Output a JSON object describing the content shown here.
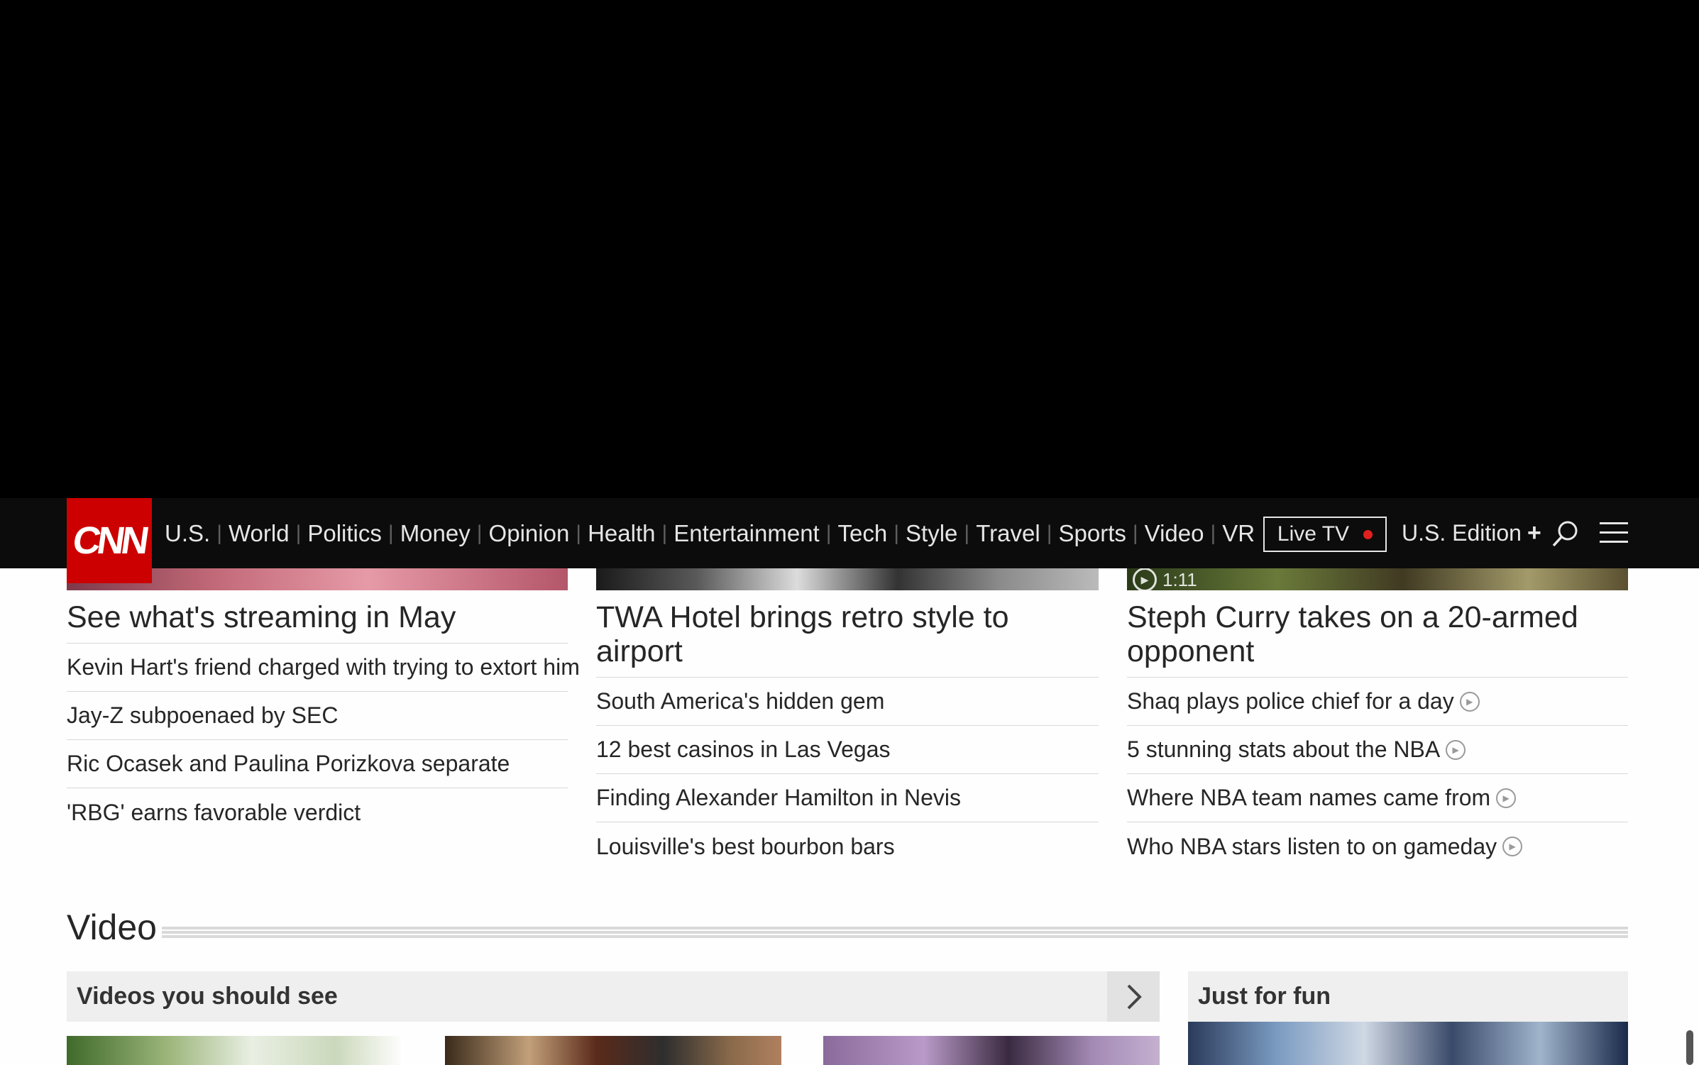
{
  "nav": {
    "logo": "CNN",
    "links": [
      "U.S.",
      "World",
      "Politics",
      "Money",
      "Opinion",
      "Health",
      "Entertainment",
      "Tech",
      "Style",
      "Travel",
      "Sports",
      "Video",
      "VR"
    ],
    "live_tv": "Live TV",
    "edition": "U.S. Edition",
    "edition_plus": "+"
  },
  "columns": [
    {
      "headline": "See what's streaming in May",
      "stories": [
        {
          "text": "Kevin Hart's friend charged with trying to extort him"
        },
        {
          "text": "Jay-Z subpoenaed by SEC"
        },
        {
          "text": "Ric Ocasek and Paulina Porizkova separate"
        },
        {
          "text": "'RBG' earns favorable verdict"
        }
      ]
    },
    {
      "headline": "TWA Hotel brings retro style to airport",
      "stories": [
        {
          "text": "South America's hidden gem"
        },
        {
          "text": "12 best casinos in Las Vegas"
        },
        {
          "text": "Finding Alexander Hamilton in Nevis"
        },
        {
          "text": "Louisville's best bourbon bars"
        }
      ]
    },
    {
      "duration": "1:11",
      "headline": "Steph Curry takes on a 20-armed opponent",
      "stories": [
        {
          "text": "Shaq plays police chief for a day",
          "video": true
        },
        {
          "text": "5 stunning stats about the NBA",
          "video": true
        },
        {
          "text": "Where NBA team names came from",
          "video": true
        },
        {
          "text": "Who NBA stars listen to on gameday",
          "video": true
        }
      ]
    }
  ],
  "video_section": {
    "title": "Video",
    "carousel_label": "Videos you should see",
    "side_label": "Just for fun"
  },
  "colors": {
    "brand_red": "#cc0000",
    "nav_bg": "#0c0c0c",
    "live_dot": "#e0201f"
  }
}
